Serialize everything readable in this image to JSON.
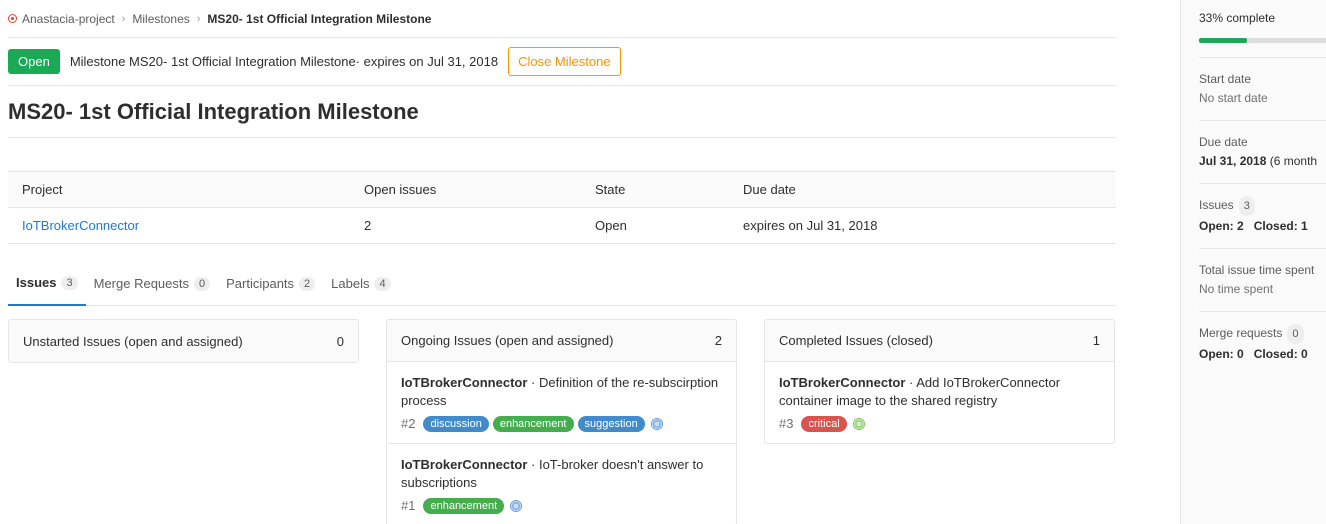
{
  "breadcrumb": {
    "project": "Anastacia-project",
    "milestones": "Milestones",
    "current": "MS20- 1st Official Integration Milestone"
  },
  "detail": {
    "status": "Open",
    "description": "Milestone MS20- 1st Official Integration Milestone· expires on Jul 31, 2018",
    "close_label": "Close Milestone"
  },
  "title": "MS20- 1st Official Integration Milestone",
  "table": {
    "headers": [
      "Project",
      "Open issues",
      "State",
      "Due date"
    ],
    "row": {
      "project": "IoTBrokerConnector",
      "open_issues": "2",
      "state": "Open",
      "due": "expires on Jul 31, 2018"
    }
  },
  "tabs": [
    {
      "label": "Issues",
      "count": "3"
    },
    {
      "label": "Merge Requests",
      "count": "0"
    },
    {
      "label": "Participants",
      "count": "2"
    },
    {
      "label": "Labels",
      "count": "4"
    }
  ],
  "boards": {
    "unstarted": {
      "title": "Unstarted Issues (open and assigned)",
      "count": "0"
    },
    "ongoing": {
      "title": "Ongoing Issues (open and assigned)",
      "count": "2",
      "cards": [
        {
          "project": "IoTBrokerConnector",
          "text": " · Definition of the re-subscirption process",
          "num": "#2",
          "labels": [
            "discussion",
            "enhancement",
            "suggestion"
          ]
        },
        {
          "project": "IoTBrokerConnector",
          "text": " · IoT-broker doesn't answer to subscriptions",
          "num": "#1",
          "labels": [
            "enhancement"
          ]
        }
      ]
    },
    "completed": {
      "title": "Completed Issues (closed)",
      "count": "1",
      "cards": [
        {
          "project": "IoTBrokerConnector",
          "text": " · Add IoTBrokerConnector container image to the shared registry",
          "num": "#3",
          "labels": [
            "critical"
          ]
        }
      ]
    }
  },
  "label_colors": {
    "discussion": "#428bca",
    "enhancement": "#44ad4e",
    "suggestion": "#428bca",
    "critical": "#d9534f"
  },
  "sidebar": {
    "progress_text": "33% complete",
    "progress_fraction": 0.33,
    "start_title": "Start date",
    "start_value": "No start date",
    "due_title": "Due date",
    "due_value": "Jul 31, 2018",
    "due_extra": " (6 month",
    "issues_title": "Issues",
    "issues_count": "3",
    "issues_open": "Open: 2",
    "issues_closed": "Closed: 1",
    "time_title": "Total issue time spent",
    "time_value": "No time spent",
    "mr_title": "Merge requests",
    "mr_count": "0",
    "mr_open": "Open: 0",
    "mr_closed": "Closed: 0"
  }
}
